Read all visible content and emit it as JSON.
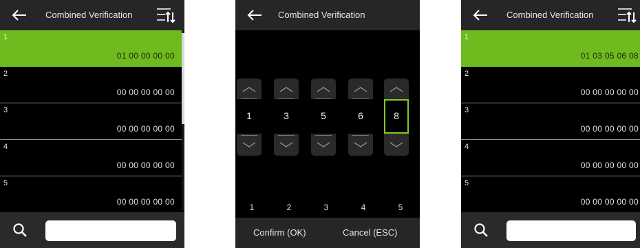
{
  "left": {
    "title": "Combined Verification",
    "rows": [
      {
        "index": "1",
        "value": "01 00 00 00 00"
      },
      {
        "index": "2",
        "value": "00 00 00 00 00"
      },
      {
        "index": "3",
        "value": "00 00 00 00 00"
      },
      {
        "index": "4",
        "value": "00 00 00 00 00"
      },
      {
        "index": "5",
        "value": "00 00 00 00 00"
      }
    ],
    "search_value": ""
  },
  "middle": {
    "title": "Combined Verification",
    "pickers": [
      {
        "value": "1",
        "label": "1"
      },
      {
        "value": "3",
        "label": "2"
      },
      {
        "value": "5",
        "label": "3"
      },
      {
        "value": "6",
        "label": "4"
      },
      {
        "value": "8",
        "label": "5"
      }
    ],
    "confirm_label": "Confirm (OK)",
    "cancel_label": "Cancel (ESC)"
  },
  "right": {
    "title": "Combined Verification",
    "rows": [
      {
        "index": "1",
        "value": "01 03 05 06 08"
      },
      {
        "index": "2",
        "value": "00 00 00 00 00"
      },
      {
        "index": "3",
        "value": "00 00 00 00 00"
      },
      {
        "index": "4",
        "value": "00 00 00 00 00"
      },
      {
        "index": "5",
        "value": "00 00 00 00 00"
      }
    ],
    "search_value": ""
  },
  "colors": {
    "accent_green": "#6fbb1f",
    "active_border": "#7fcb2a",
    "bar_gray": "#262626"
  }
}
